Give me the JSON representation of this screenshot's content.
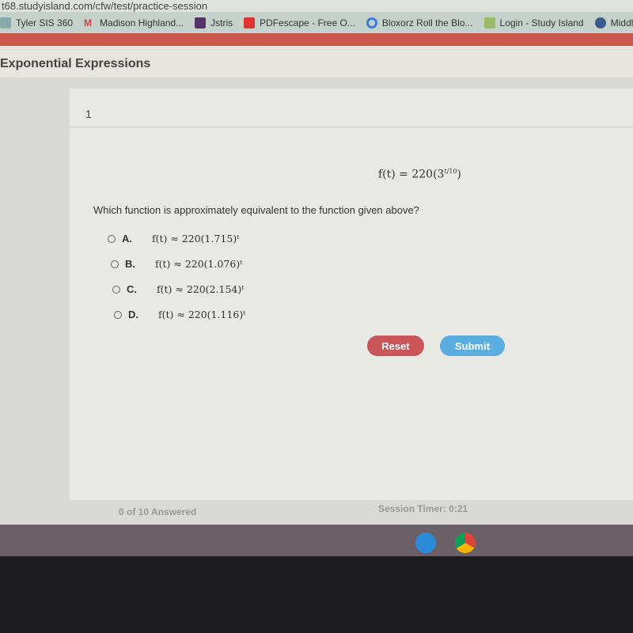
{
  "browser": {
    "url": "t68.studyisland.com/cfw/test/practice-session",
    "bookmarks": [
      {
        "label": "Tyler SIS 360",
        "icon": "sis-icon"
      },
      {
        "label": "Madison Highland...",
        "icon": "gmail-icon"
      },
      {
        "label": "Jstris",
        "icon": "jstris-icon"
      },
      {
        "label": "PDFescape - Free O...",
        "icon": "pdf-icon"
      },
      {
        "label": "Bloxorz Roll the Blo...",
        "icon": "google-icon"
      },
      {
        "label": "Login - Study Island",
        "icon": "studyisland-icon"
      },
      {
        "label": "Middlebur",
        "icon": "chat-icon"
      }
    ]
  },
  "header": {
    "title": "Exponential Expressions"
  },
  "question": {
    "number": "1",
    "equation": "f(t) = 220(3",
    "exponent": "t/10",
    "close": ")",
    "prompt": "Which function is approximately equivalent to the function given above?",
    "options": [
      {
        "letter": "A.",
        "text": "f(t) ≈ 220(1.715)ᵗ"
      },
      {
        "letter": "B.",
        "text": "f(t) ≈ 220(1.076)ᵗ"
      },
      {
        "letter": "C.",
        "text": "f(t) ≈ 220(2.154)ᵗ"
      },
      {
        "letter": "D.",
        "text": "f(t) ≈ 220(1.116)ᵗ"
      }
    ]
  },
  "buttons": {
    "reset": "Reset",
    "submit": "Submit",
    "reset_color": "#c9575a",
    "submit_color": "#5aaee0"
  },
  "footer": {
    "answered": "0 of 10 Answered",
    "timer": "Session Timer: 0:21"
  }
}
